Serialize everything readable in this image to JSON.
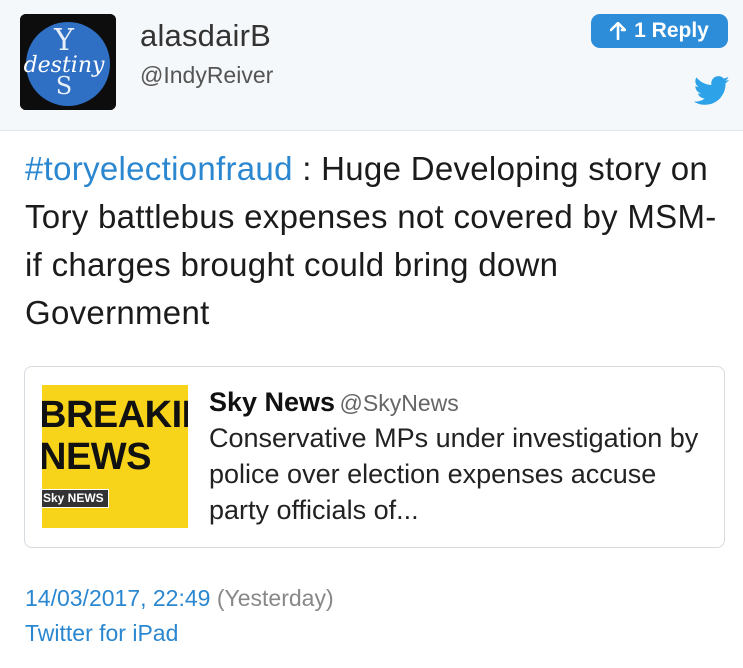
{
  "user": {
    "display_name": "alasdairB",
    "handle": "@IndyReiver",
    "avatar_text": "Yes destiny"
  },
  "reply_button": {
    "count_label": "1 Reply"
  },
  "tweet": {
    "hashtag": "#toryelectionfraud",
    "text": " : Huge Developing story on Tory battlebus expenses not covered by MSM- if charges brought could bring down Government"
  },
  "quoted": {
    "author": "Sky News",
    "handle": "@SkyNews",
    "text": "Conservative MPs under investigation by police over election expenses accuse party officials of...",
    "image_line1": "BREAKING",
    "image_line2": "NEWS",
    "image_logo": "Sky NEWS"
  },
  "meta": {
    "timestamp": "14/03/2017, 22:49",
    "relative": "(Yesterday)",
    "source": "Twitter for iPad"
  },
  "colors": {
    "link": "#2b87d0",
    "reply_button": "#2d8dd8",
    "header_bg": "#f5f8fa",
    "breaking_bg": "#f7d31a"
  },
  "icons": [
    "avatar-image",
    "up-arrow-icon",
    "twitter-bird-icon"
  ]
}
